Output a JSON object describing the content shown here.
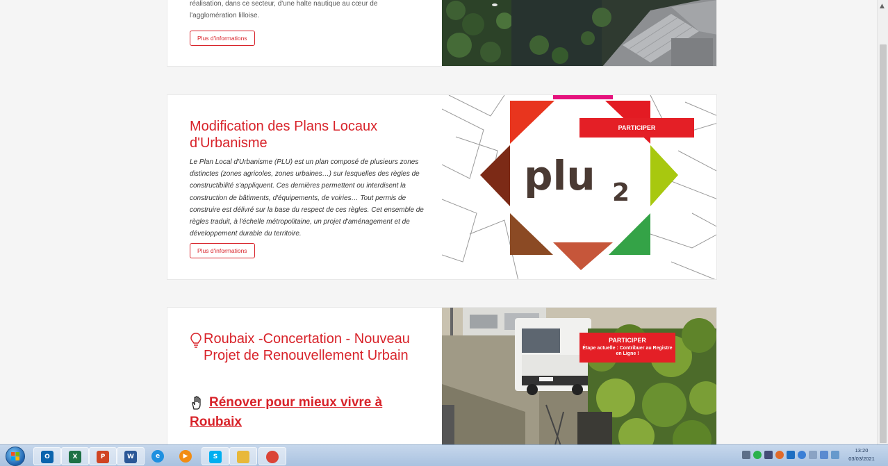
{
  "card1": {
    "desc_line1": "réalisation, dans ce secteur, d'une halte nautique au cœur de",
    "desc_line2": "l'agglomération lilloise.",
    "more_label": "Plus d'informations"
  },
  "card2": {
    "title": "Modification des Plans Locaux d'Urbanisme",
    "description": "Le Plan Local d'Urbanisme (PLU) est un plan composé de plusieurs zones distinctes (zones agricoles, zones urbaines…) sur lesquelles des règles de constructibilité s'appliquent. Ces dernières permettent ou interdisent la construction de bâtiments, d'équipements, de voiries… Tout permis de construire est délivré sur la base du respect de ces règles. Cet ensemble de règles traduit, à l'échelle métropolitaine, un projet d'aménagement et de développement durable du territoire.",
    "more_label": "Plus d'informations",
    "participer_label": "PARTICIPER",
    "logo_text": "plu",
    "logo_sub": "2"
  },
  "card3": {
    "title": "Roubaix -Concertation - Nouveau Projet de Renouvellement Urbain",
    "subtitle_line1": "Rénover pour mieux vivre à",
    "subtitle_line2": "Roubaix",
    "participer_label": "PARTICIPER",
    "stage_label": "Étape actuelle : Contribuer au Registre en Ligne !"
  },
  "taskbar": {
    "apps": [
      {
        "name": "outlook",
        "letter": "O",
        "color": "#0a64ad"
      },
      {
        "name": "excel",
        "letter": "X",
        "color": "#1e7145"
      },
      {
        "name": "powerpoint",
        "letter": "P",
        "color": "#d04423"
      },
      {
        "name": "word",
        "letter": "W",
        "color": "#2b5797"
      },
      {
        "name": "internet-explorer",
        "letter": "e",
        "color": "#1e90e0"
      },
      {
        "name": "media-player",
        "letter": "▶",
        "color": "#f28c12"
      },
      {
        "name": "skype",
        "letter": "S",
        "color": "#00aff0"
      },
      {
        "name": "file-explorer",
        "letter": "",
        "color": "#e8b83a"
      },
      {
        "name": "chrome",
        "letter": "",
        "color": "#db4437"
      }
    ],
    "time": "13:20",
    "date": "03/03/2021"
  },
  "colors": {
    "accent": "#d8232a",
    "participer": "#e41f26"
  }
}
